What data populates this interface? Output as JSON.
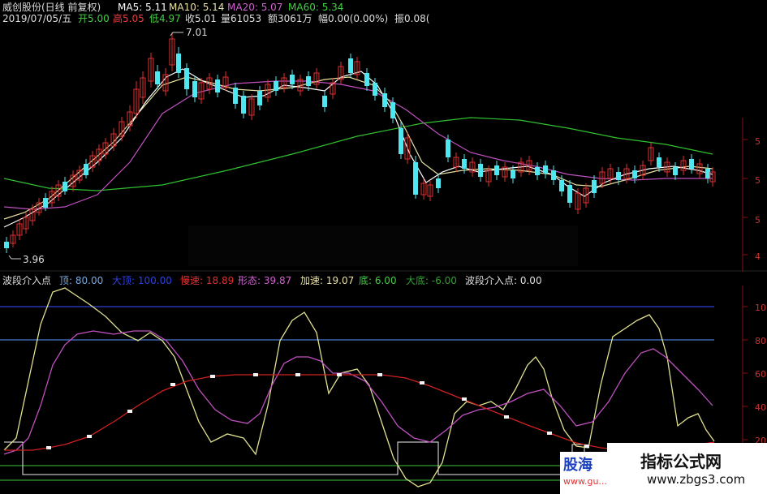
{
  "header": {
    "name": "威创股份(日线 前复权)",
    "ma5_label": "MA5: 5.11",
    "ma10_label": "MA10: 5.14",
    "ma20_label": "MA20: 5.07",
    "ma60_label": "MA60: 5.34",
    "date": "2019/07/05/五",
    "open": "开5.00",
    "high": "高5.05",
    "low": "低4.97",
    "close": "收5.01",
    "volume": "量61053",
    "amount": "额3061万",
    "change": "幅0.00(0.00%)",
    "amplitude": "振0.08("
  },
  "annotations": {
    "high_mark": "7.01",
    "low_mark": "3.96"
  },
  "price_axis": [
    "5",
    "5",
    "5",
    "4"
  ],
  "indicator": {
    "title": "波段介入点",
    "top": "顶: 80.00",
    "big_top": "大顶: 100.00",
    "slow": "慢速: 18.89",
    "shape": "形态: 39.87",
    "fast": "加速: 19.07",
    "bottom": "底: 6.00",
    "big_bottom": "大底: -6.00",
    "entry": "波段介入点: 0.00"
  },
  "indicator_axis": [
    "10",
    "80",
    "60",
    "40",
    "20"
  ],
  "watermarks": {
    "left_text": "股海",
    "left_url": "www.gu...",
    "right_title": "指标公式网",
    "right_url": "www.zbgs3.com"
  },
  "colors": {
    "up": "#e03030",
    "down": "#4fe6f0",
    "ma5": "#ffffff",
    "ma10": "#e8e0a0",
    "ma20": "#c050c0",
    "ma60": "#30c030",
    "top_line": "#4a7ad0",
    "big_top_line": "#3040d0",
    "slow": "#e0e090",
    "shape": "#c050c0",
    "fast": "#d02020",
    "bottom_line": "#30a030"
  }
}
